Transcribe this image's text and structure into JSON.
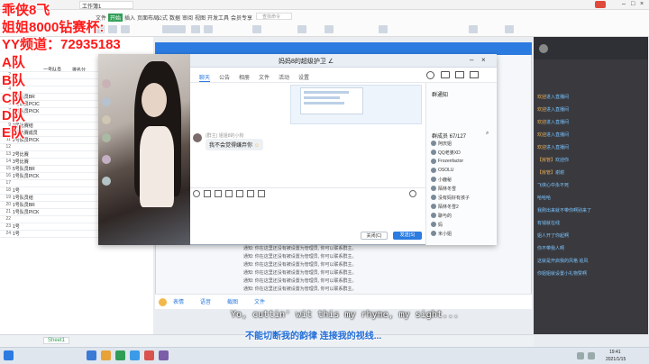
{
  "overlay": {
    "line1": "乖侠8飞",
    "line2": "姐姐8000钻赛杯:",
    "line3": "YY频道：72935183",
    "teams": [
      "A队",
      "B队",
      "C队",
      "D队",
      "E队"
    ]
  },
  "wps": {
    "tab_title": "工作簿1",
    "menu": [
      "文件",
      "开始",
      "插入",
      "页面布局",
      "公式",
      "数据",
      "审阅",
      "视图",
      "开发工具",
      "会员专享"
    ],
    "search_placeholder": "查找命令",
    "sheet_tab": "Sheet1"
  },
  "sheet": {
    "header_cells": [
      "一号队员",
      "排名分"
    ],
    "rows": [
      "",
      "",
      "",
      "",
      "1号队员BR",
      "1号队员PCIC",
      "1号队员PICK",
      "",
      "2号比赛结",
      "2号比赛成员",
      "2号队员PICK",
      "",
      "2号比赛",
      "3号比赛",
      "5号队员BR",
      "1号队员PICK",
      "",
      "1号",
      "1号队员结",
      "1号队员BR",
      "1号队员PICK",
      "",
      "1号",
      "1号"
    ]
  },
  "chat": {
    "group_title": "妈妈8的超级护卫 ∠",
    "tabs": [
      "聊天",
      "公告",
      "相册",
      "文件",
      "活动",
      "设置"
    ],
    "members_label": "群成员 67/127",
    "notice_label": "群通知",
    "bubble_name": "(群主) 姐姐8的小狗",
    "bubble_text": "我不会觉得嫌弃你",
    "send_button": "发送(S)",
    "close_button": "关闭(C)",
    "members": [
      "阿庆姐",
      "QQ老婆XD",
      "Frozenfactor",
      "OSOLU",
      "小鹿秘",
      "陌林冬雪",
      "没有妈好有孩子",
      "陌林冬雪2",
      "聊与的",
      "妈",
      "米小姐"
    ],
    "system_messages": [
      "通知: 你在这里还没有被设置为管理员, 你可以联系群主。",
      "通知: 你在这里还没有被设置为管理员, 你可以联系群主。",
      "通知: 你在这里还没有被设置为管理员, 你可以联系群主。",
      "通知: 你在这里还没有被设置为管理员, 你可以联系群主。",
      "通知: 你在这里还没有被设置为管理员, 你可以联系群主。",
      "通知: 你在这里还没有被设置为管理员, 你可以联系群主。"
    ],
    "input_tools": [
      "表情",
      "语音",
      "截图",
      "文件"
    ]
  },
  "stream_chat": [
    {
      "user": "欢迎",
      "text": "进入直播间"
    },
    {
      "user": "欢迎",
      "text": "进入直播间"
    },
    {
      "user": "欢迎",
      "text": "进入直播间"
    },
    {
      "user": "欢迎",
      "text": "进入直播间"
    },
    {
      "user": "欢迎",
      "text": "进入直播间"
    },
    {
      "user": "【房管】",
      "text": "欢迎你"
    },
    {
      "user": "【房管】",
      "text": "谢谢"
    },
    {
      "user": "",
      "text": "飞侠心中永不死"
    },
    {
      "user": "",
      "text": "哈哈哈"
    },
    {
      "user": "",
      "text": "我刚出来就不带你啊别来了"
    },
    {
      "user": "",
      "text": "有钱就在线"
    },
    {
      "user": "",
      "text": "姐人开了你起啊"
    },
    {
      "user": "",
      "text": "你不带我人啊"
    },
    {
      "user": "",
      "text": "这就是开启我的风格 追风"
    },
    {
      "user": "",
      "text": "你姐姐就设置小礼物赞啊"
    }
  ],
  "subtitles": {
    "english": "Yo, cuttin' wit this my rhyme, my sight...",
    "chinese": "不能切断我的韵律 连接我的视线..."
  },
  "taskbar": {
    "time": "19:41",
    "date": "2021/1/15"
  },
  "colors": {
    "overlay_red": "#ff1a1a",
    "qq_blue": "#2b7be0",
    "subtitle_blue": "#1f6bd6"
  }
}
